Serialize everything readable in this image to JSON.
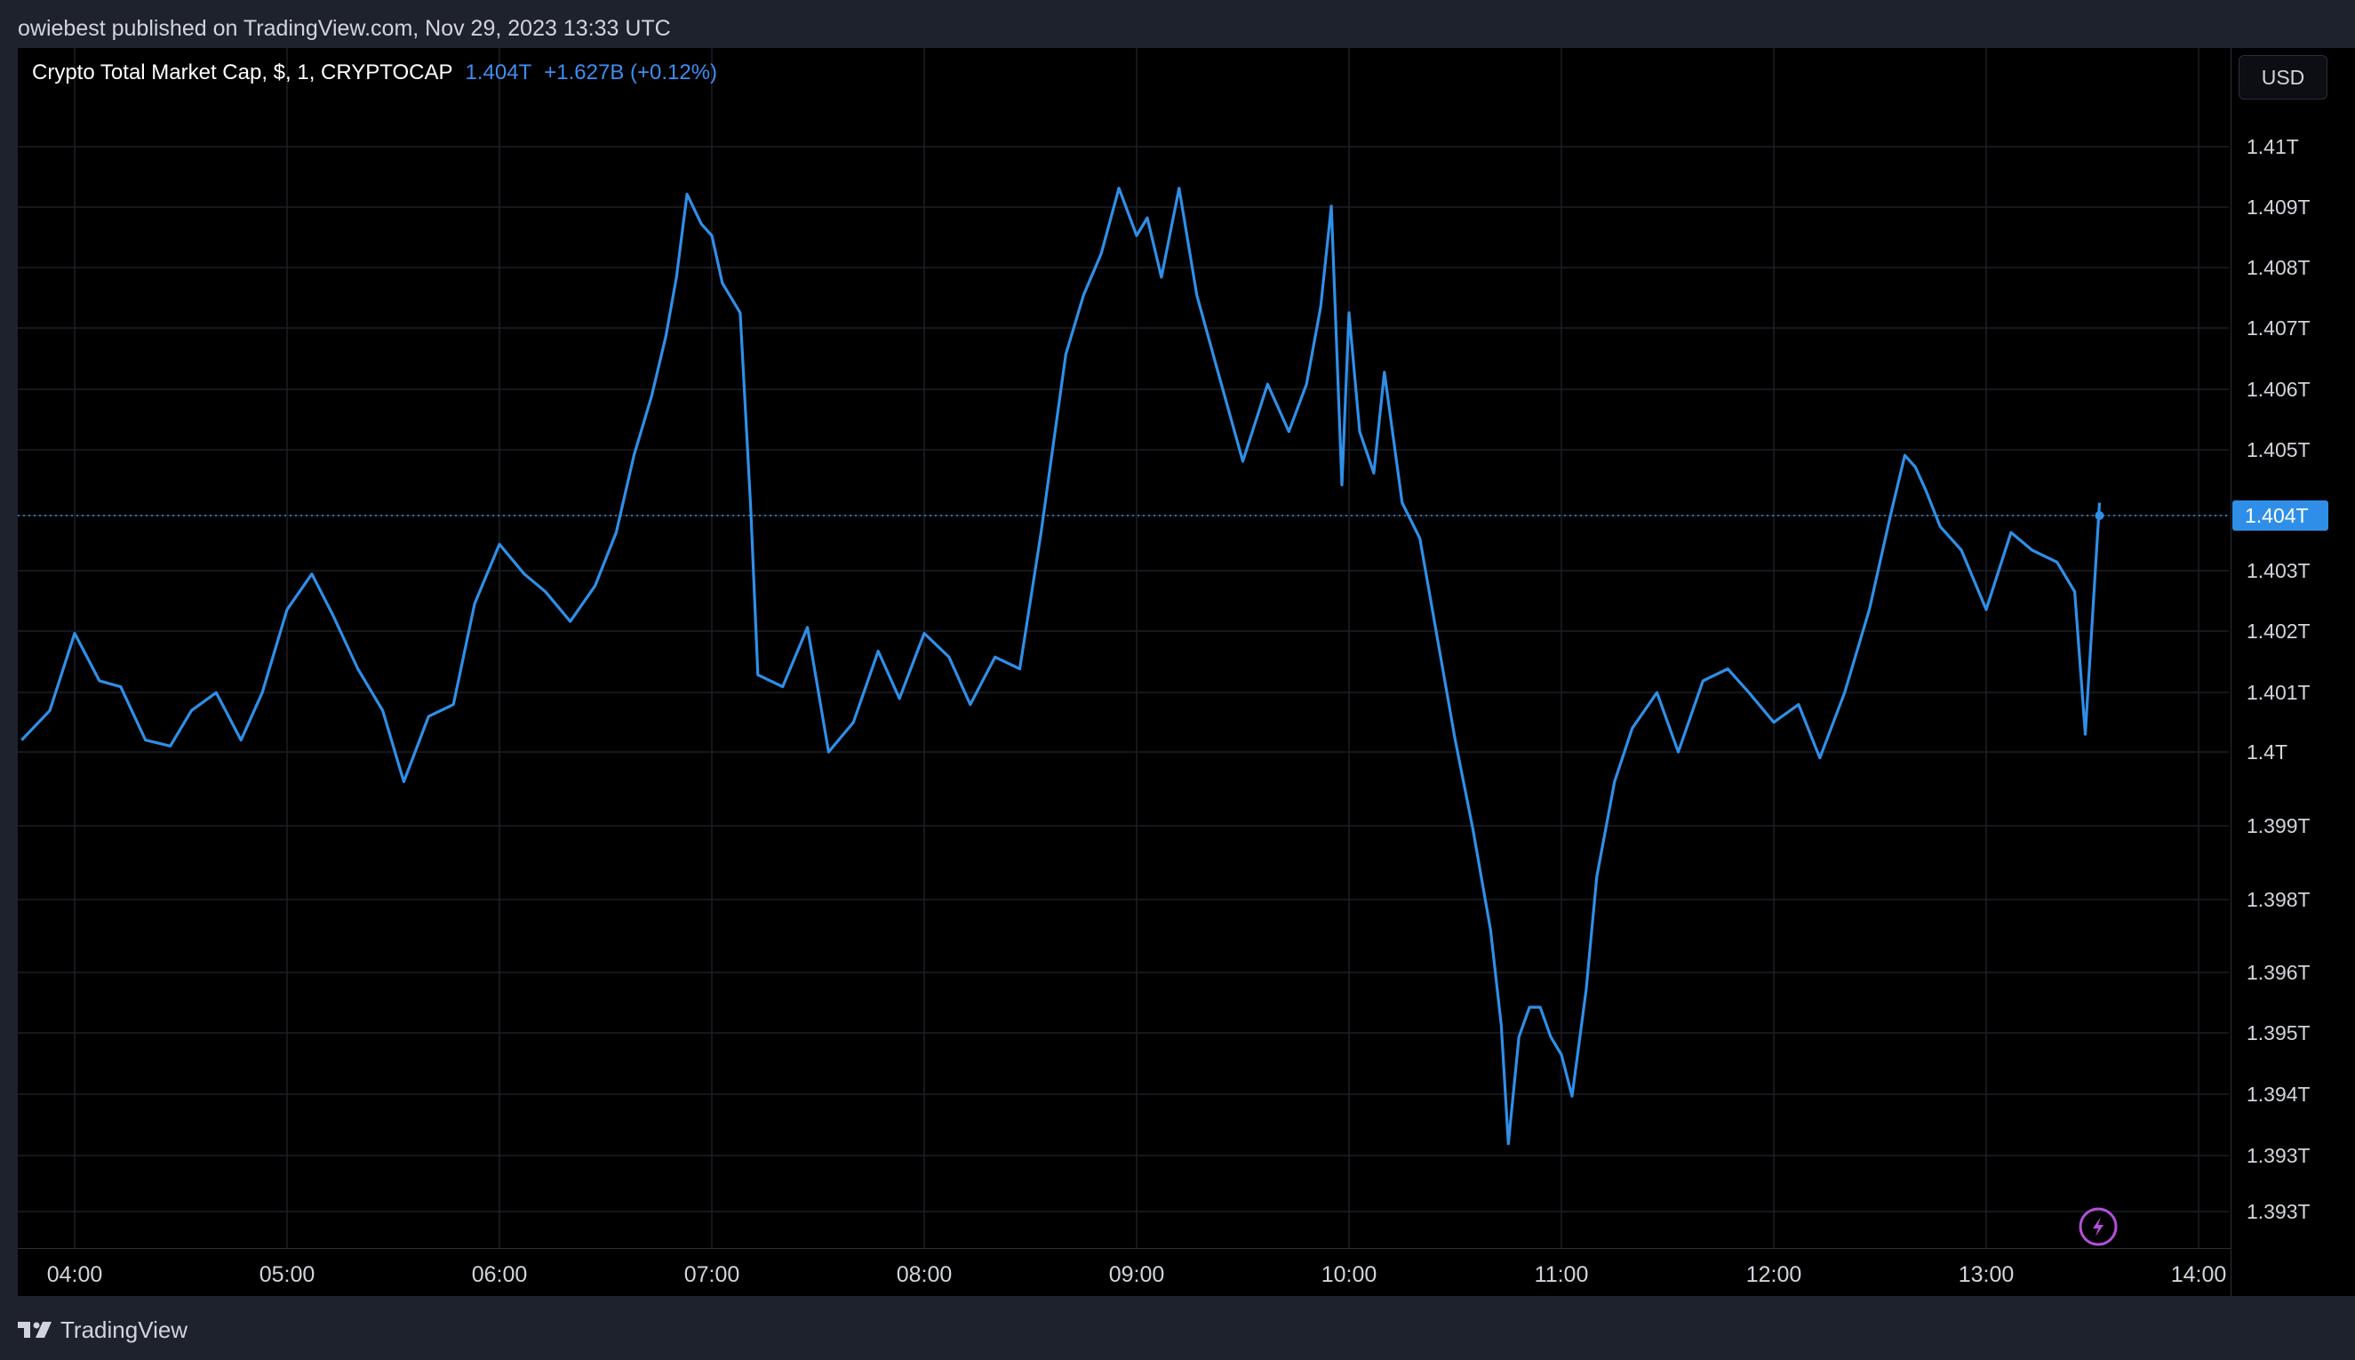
{
  "header": {
    "publish_line": "owiebest published on TradingView.com, Nov 29, 2023 13:33 UTC"
  },
  "legend": {
    "symbol": "Crypto Total Market Cap, $, 1, CRYPTOCAP",
    "last_value": "1.404T",
    "change": "+1.627B (+0.12%)"
  },
  "currency_button": {
    "label": "USD"
  },
  "footer": {
    "brand": "TradingView"
  },
  "colors": {
    "line": "#2f8fe8",
    "grid": "#1c1f26",
    "badge": "#2f8fe8",
    "flash": "#b44fd9"
  },
  "icons": [
    "tradingview-logo-icon",
    "flash-icon"
  ],
  "chart_data": {
    "type": "line",
    "title": "Crypto Total Market Cap, $, 1, CRYPTOCAP",
    "xlabel": "",
    "ylabel": "",
    "x_ticks": [
      "04:00",
      "05:00",
      "06:00",
      "07:00",
      "08:00",
      "09:00",
      "10:00",
      "11:00",
      "12:00",
      "13:00",
      "14:00"
    ],
    "y_ticks": [
      "1.41T",
      "1.409T",
      "1.408T",
      "1.407T",
      "1.406T",
      "1.405T",
      "1.404T",
      "1.403T",
      "1.402T",
      "1.401T",
      "1.4T",
      "1.399T",
      "1.398T",
      "1.396T",
      "1.395T",
      "1.394T",
      "1.393T",
      "1.393T"
    ],
    "last_price_label": "1.404T",
    "ylim": [
      1.3928,
      1.4115
    ],
    "xlim": [
      "03:45",
      "14:10"
    ],
    "grid": true,
    "series": [
      {
        "x": [
          "03:45",
          "03:53",
          "04:00",
          "04:07",
          "04:13",
          "04:20",
          "04:27",
          "04:33",
          "04:40",
          "04:47",
          "04:53",
          "05:00",
          "05:07",
          "05:13",
          "05:20",
          "05:27",
          "05:33",
          "05:40",
          "05:47",
          "05:53",
          "06:00",
          "06:07",
          "06:13",
          "06:20",
          "06:27",
          "06:33",
          "06:38",
          "06:43",
          "06:47",
          "06:50",
          "06:53",
          "06:57",
          "07:00",
          "07:03",
          "07:08",
          "07:11",
          "07:13",
          "07:20",
          "07:27",
          "07:33",
          "07:40",
          "07:47",
          "07:53",
          "08:00",
          "08:07",
          "08:13",
          "08:20",
          "08:27",
          "08:33",
          "08:40",
          "08:45",
          "08:50",
          "08:55",
          "09:00",
          "09:03",
          "09:07",
          "09:12",
          "09:17",
          "09:23",
          "09:30",
          "09:37",
          "09:43",
          "09:48",
          "09:52",
          "09:55",
          "09:58",
          "10:00",
          "10:03",
          "10:07",
          "10:10",
          "10:15",
          "10:20",
          "10:25",
          "10:30",
          "10:35",
          "10:40",
          "10:43",
          "10:45",
          "10:48",
          "10:51",
          "10:54",
          "10:57",
          "11:00",
          "11:03",
          "11:07",
          "11:10",
          "11:15",
          "11:20",
          "11:27",
          "11:33",
          "11:40",
          "11:47",
          "11:53",
          "12:00",
          "12:07",
          "12:13",
          "12:20",
          "12:27",
          "12:33",
          "12:37",
          "12:40",
          "12:43",
          "12:47",
          "12:53",
          "13:00",
          "13:07",
          "13:13",
          "13:20",
          "13:25",
          "13:28",
          "13:32"
        ],
        "y": [
          1.4,
          1.4005,
          1.4018,
          1.401,
          1.4009,
          1.4,
          1.3999,
          1.4005,
          1.4008,
          1.4,
          1.4008,
          1.4022,
          1.4028,
          1.4021,
          1.4012,
          1.4005,
          1.3993,
          1.4004,
          1.4006,
          1.4023,
          1.4033,
          1.4028,
          1.4025,
          1.402,
          1.4026,
          1.4035,
          1.4048,
          1.4058,
          1.4068,
          1.4078,
          1.4092,
          1.4087,
          1.4085,
          1.4077,
          1.4072,
          1.4039,
          1.4011,
          1.4009,
          1.4019,
          1.3998,
          1.4003,
          1.4015,
          1.4007,
          1.4018,
          1.4014,
          1.4006,
          1.4014,
          1.4012,
          1.4035,
          1.4065,
          1.4075,
          1.4082,
          1.4093,
          1.4085,
          1.4088,
          1.4078,
          1.4093,
          1.4075,
          1.4062,
          1.4047,
          1.406,
          1.4052,
          1.406,
          1.4073,
          1.409,
          1.4043,
          1.4072,
          1.4052,
          1.4045,
          1.4062,
          1.404,
          1.4034,
          1.4017,
          1.4,
          1.3985,
          1.3968,
          1.3952,
          1.3932,
          1.395,
          1.3955,
          1.3955,
          1.395,
          1.3947,
          1.394,
          1.3958,
          1.3977,
          1.3993,
          1.4002,
          1.4008,
          1.3998,
          1.401,
          1.4012,
          1.4008,
          1.4003,
          1.4006,
          1.3997,
          1.4008,
          1.4022,
          1.4038,
          1.4048,
          1.4046,
          1.4042,
          1.4036,
          1.4032,
          1.4022,
          1.4035,
          1.4032,
          1.403,
          1.4025,
          1.4001,
          1.404
        ]
      }
    ]
  }
}
